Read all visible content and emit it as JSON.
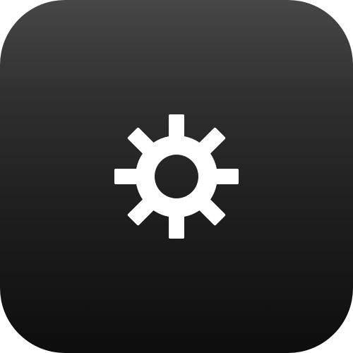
{
  "app_icon": {
    "name": "settings",
    "icon": "gear-icon",
    "background_top": "#474747",
    "background_bottom": "#0d0d0d",
    "glyph_color": "#ffffff"
  }
}
